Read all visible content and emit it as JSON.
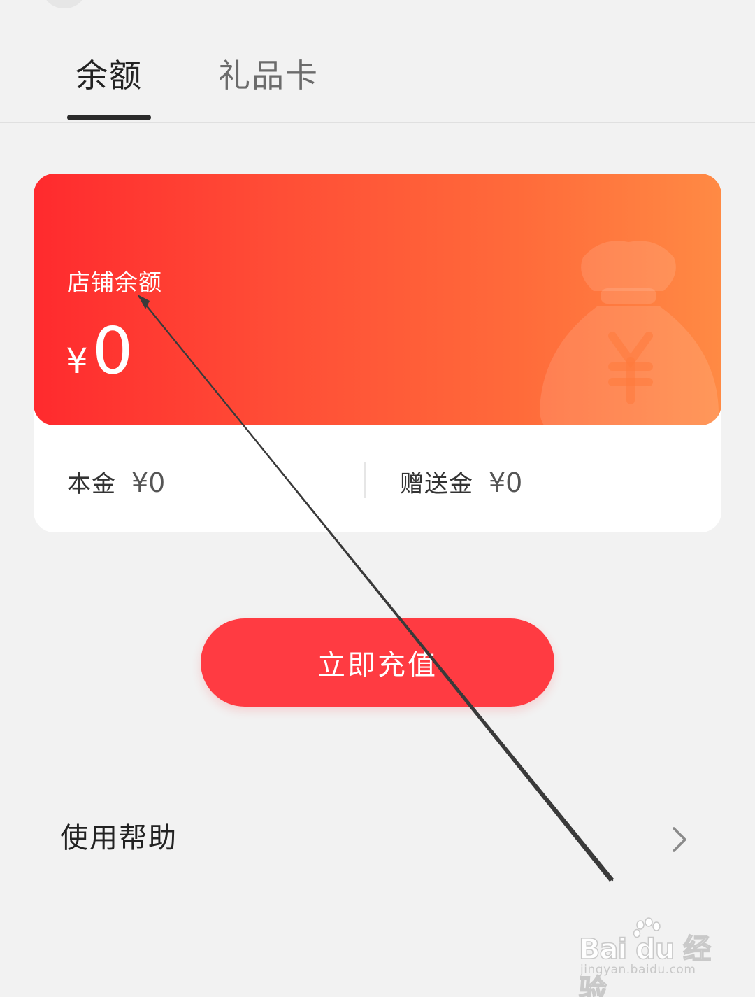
{
  "tabs": [
    {
      "label": "余额",
      "active": true
    },
    {
      "label": "礼品卡",
      "active": false
    }
  ],
  "balance_card": {
    "label": "店铺余额",
    "currency": "¥",
    "amount": "0",
    "principal": {
      "label": "本金",
      "value": "¥0"
    },
    "bonus": {
      "label": "赠送金",
      "value": "¥0"
    },
    "background_icon": "money-bag-icon"
  },
  "recharge_button": {
    "label": "立即充值"
  },
  "help": {
    "label": "使用帮助",
    "icon": "chevron-right-icon"
  },
  "watermark": {
    "logo": "Bai  du 经验",
    "url": "jingyan.baidu.com"
  },
  "colors": {
    "accent_red": "#ff3b42",
    "card_gradient_start": "#ff2a2e",
    "card_gradient_end": "#ff8a44",
    "background": "#f2f2f2"
  }
}
